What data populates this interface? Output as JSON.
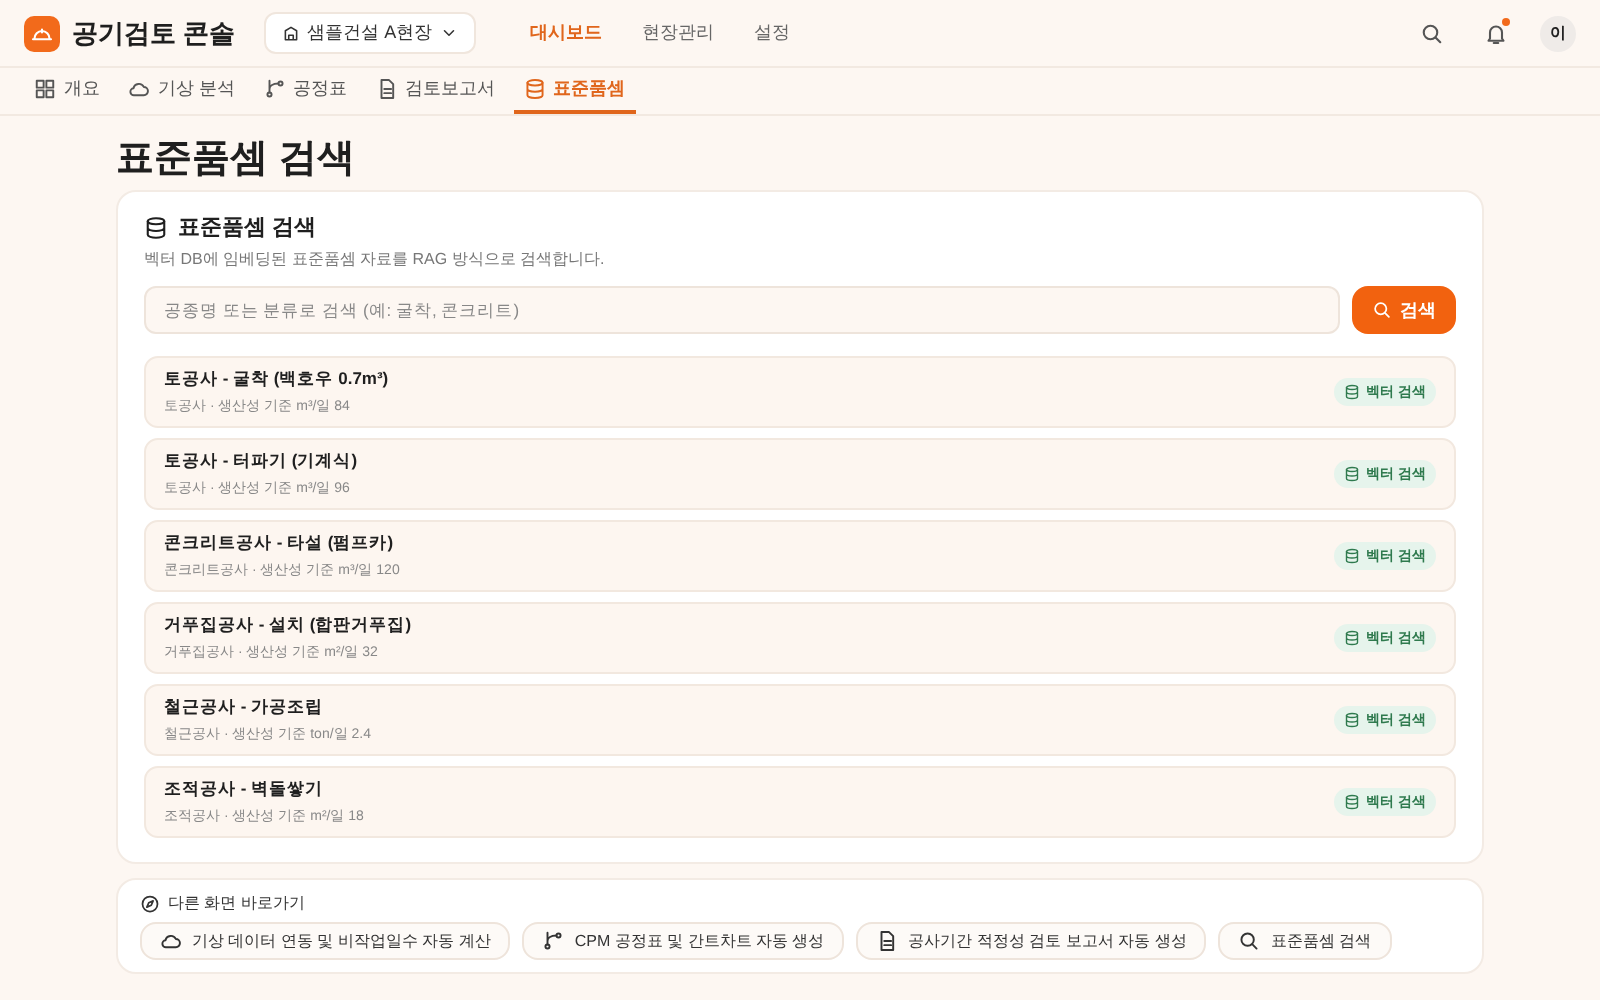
{
  "header": {
    "logo_text": "공기검토 콘솔",
    "site_selector": "샘플건설 A현장",
    "nav": [
      {
        "label": "대시보드",
        "selected": true
      },
      {
        "label": "현장관리",
        "selected": false
      },
      {
        "label": "설정",
        "selected": false
      }
    ],
    "avatar": "이"
  },
  "tabs": [
    {
      "label": "개요",
      "selected": false
    },
    {
      "label": "기상 분석",
      "selected": false
    },
    {
      "label": "공정표",
      "selected": false
    },
    {
      "label": "검토보고서",
      "selected": false
    },
    {
      "label": "표준품셈",
      "selected": true
    }
  ],
  "page_title": "표준품셈 검색",
  "search_card": {
    "title": "표준품셈 검색",
    "description": "벡터 DB에 임베딩된 표준품셈 자료를 RAG 방식으로 검색합니다.",
    "placeholder": "공종명 또는 분류로 검색 (예: 굴착, 콘크리트)",
    "button": "검색",
    "results": [
      {
        "title": "토공사 - 굴착 (백호우 0.7m³)",
        "detail": "토공사 · 생산성 기준 m³/일 84",
        "badge": "벡터 검색"
      },
      {
        "title": "토공사 - 터파기 (기계식)",
        "detail": "토공사 · 생산성 기준 m³/일 96",
        "badge": "벡터 검색"
      },
      {
        "title": "콘크리트공사 - 타설 (펌프카)",
        "detail": "콘크리트공사 · 생산성 기준 m³/일 120",
        "badge": "벡터 검색"
      },
      {
        "title": "거푸집공사 - 설치 (합판거푸집)",
        "detail": "거푸집공사 · 생산성 기준 m²/일 32",
        "badge": "벡터 검색"
      },
      {
        "title": "철근공사 - 가공조립",
        "detail": "철근공사 · 생산성 기준 ton/일 2.4",
        "badge": "벡터 검색"
      },
      {
        "title": "조적공사 - 벽돌쌓기",
        "detail": "조적공사 · 생산성 기준 m²/일 18",
        "badge": "벡터 검색"
      }
    ]
  },
  "shortcuts": {
    "title": "다른 화면 바로가기",
    "links": [
      "기상 데이터 연동 및 비작업일수 자동 계산",
      "CPM 공정표 및 간트차트 자동 생성",
      "공사기간 적정성 검토 보고서 자동 생성",
      "표준품셈 검색"
    ]
  }
}
